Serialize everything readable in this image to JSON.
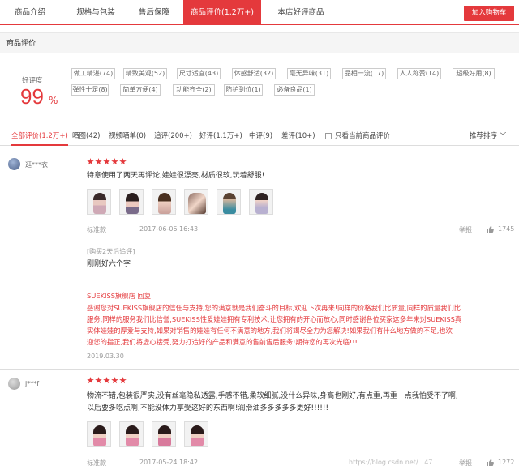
{
  "tabs": [
    {
      "label": "商品介绍"
    },
    {
      "label": "规格与包装"
    },
    {
      "label": "售后保障"
    },
    {
      "label": "商品评价(1.2万+)"
    },
    {
      "label": "本店好评商品"
    }
  ],
  "cart_button": "加入购物车",
  "section_title": "商品评价",
  "rate": {
    "label": "好评度",
    "value": "99",
    "unit": "%"
  },
  "tags": [
    "做工精湛(74)",
    "精致美观(52)",
    "尺寸适宜(43)",
    "体感舒适(32)",
    "毫无异味(31)",
    "品相一流(17)",
    "人人称赞(14)",
    "超级好用(8)",
    "弹性十足(8)",
    "简单方便(4)",
    "功能齐全(2)",
    "防护到位(1)",
    "必备良品(1)"
  ],
  "filters": [
    "全部评价(1.2万+)",
    "晒图(42)",
    "视频晒单(0)",
    "追评(200+)",
    "好评(1.1万+)",
    "中评(9)",
    "差评(10+)",
    "只看当前商品评价"
  ],
  "sort_label": "推荐排序",
  "reviews": [
    {
      "user": "逛***衣",
      "text": "特意使用了两天再评论,娃娃很漂亮,材质很软,玩着舒服!",
      "spec": "标准款",
      "date": "2017-06-06 16:43",
      "report": "举报",
      "likes": "1745",
      "followup_label": "[购买2天后追评]",
      "followup_text": "刚刚好六个字",
      "reply_title": "SUEKISS旗舰店 回复:",
      "reply_lines": [
        "感谢您对SUEKISS旗舰店的信任与支持,您的满意就是我们奋斗的目标,欢迎下次再来!同样的价格我们比质量,同样的质量我们比",
        "服务,同样的服务我们比信誉,SUEKISS性爱娃娃拥有专利技术,让您拥有的开心而放心,同时感谢各位买家这多年来对SUEKISS真",
        "实体娃娃的厚爱与支持,如果对销售的娃娃有任何不满意的地方,我们将竭尽全力为您解决!如果我们有什么地方做的不足,也欢",
        "迎您的指正,我们将虚心接受,努力打造好的产品和满意的售前售后服务!期待您的再次光临!!!"
      ],
      "reply_date": "2019.03.30"
    },
    {
      "user": "j***f",
      "text_lines": [
        "物流不错,包装很严实,没有丝毫隐私透露,手感不错,柔软细腻,没什么异味,身高也刚好,有点重,再重一点我怕受不了啊,",
        "以后要多吃点啊,不能没体力享受这好的东西啊!润滑油多多多多多更好!!!!!!"
      ],
      "spec": "标准款",
      "date": "2017-05-24 18:42",
      "report": "举报",
      "likes": "1272"
    }
  ],
  "watermark": "https://blog.csdn.net/...47",
  "colors": {
    "accent": "#e4393c",
    "chip_border": "#cccccc",
    "muted": "#999999"
  }
}
